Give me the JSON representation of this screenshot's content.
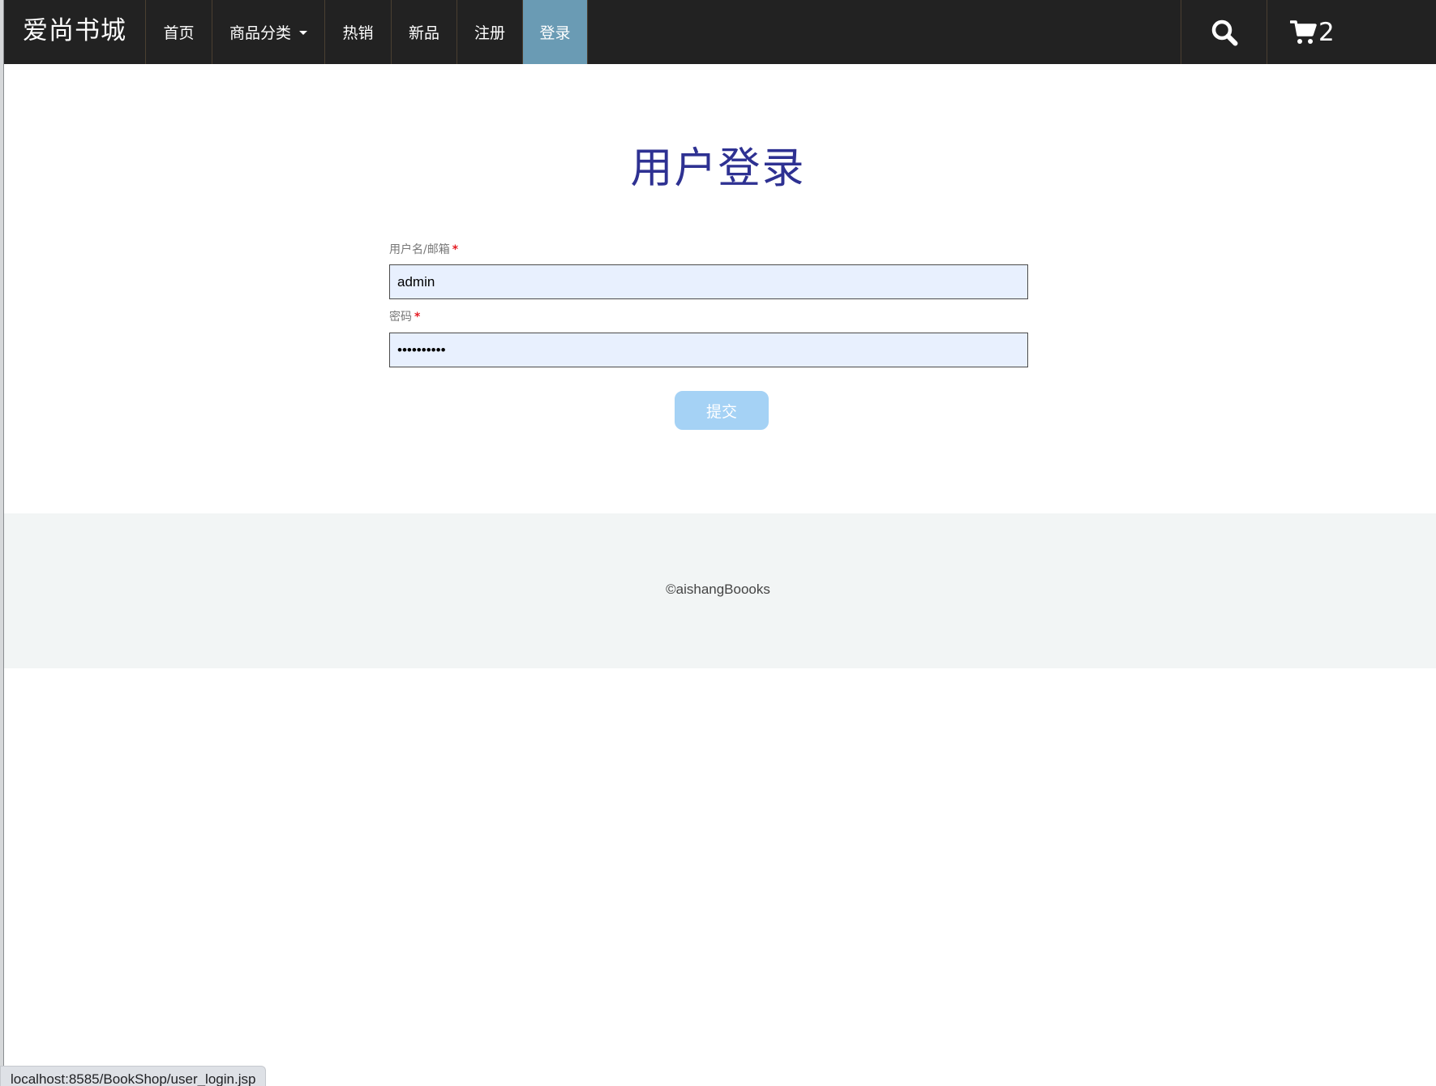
{
  "navbar": {
    "brand": "爱尚书城",
    "items": [
      {
        "label": "首页"
      },
      {
        "label": "商品分类",
        "has_dropdown": true
      },
      {
        "label": "热销"
      },
      {
        "label": "新品"
      },
      {
        "label": "注册"
      },
      {
        "label": "登录",
        "active": true
      }
    ],
    "search_icon": "search-icon",
    "cart_icon": "cart-icon",
    "cart_count": "2",
    "active_color": "#6a9bb4",
    "background_color": "#222222"
  },
  "login": {
    "title": "用户登录",
    "title_color": "#2e3192",
    "username_label": "用户名/邮箱",
    "username_value": "admin",
    "password_label": "密码",
    "password_value": "••••••••••",
    "required_mark": "*",
    "submit_label": "提交"
  },
  "footer": {
    "copyright": "©aishangBoooks"
  },
  "status_bar": {
    "url": "localhost:8585/BookShop/user_login.jsp"
  }
}
